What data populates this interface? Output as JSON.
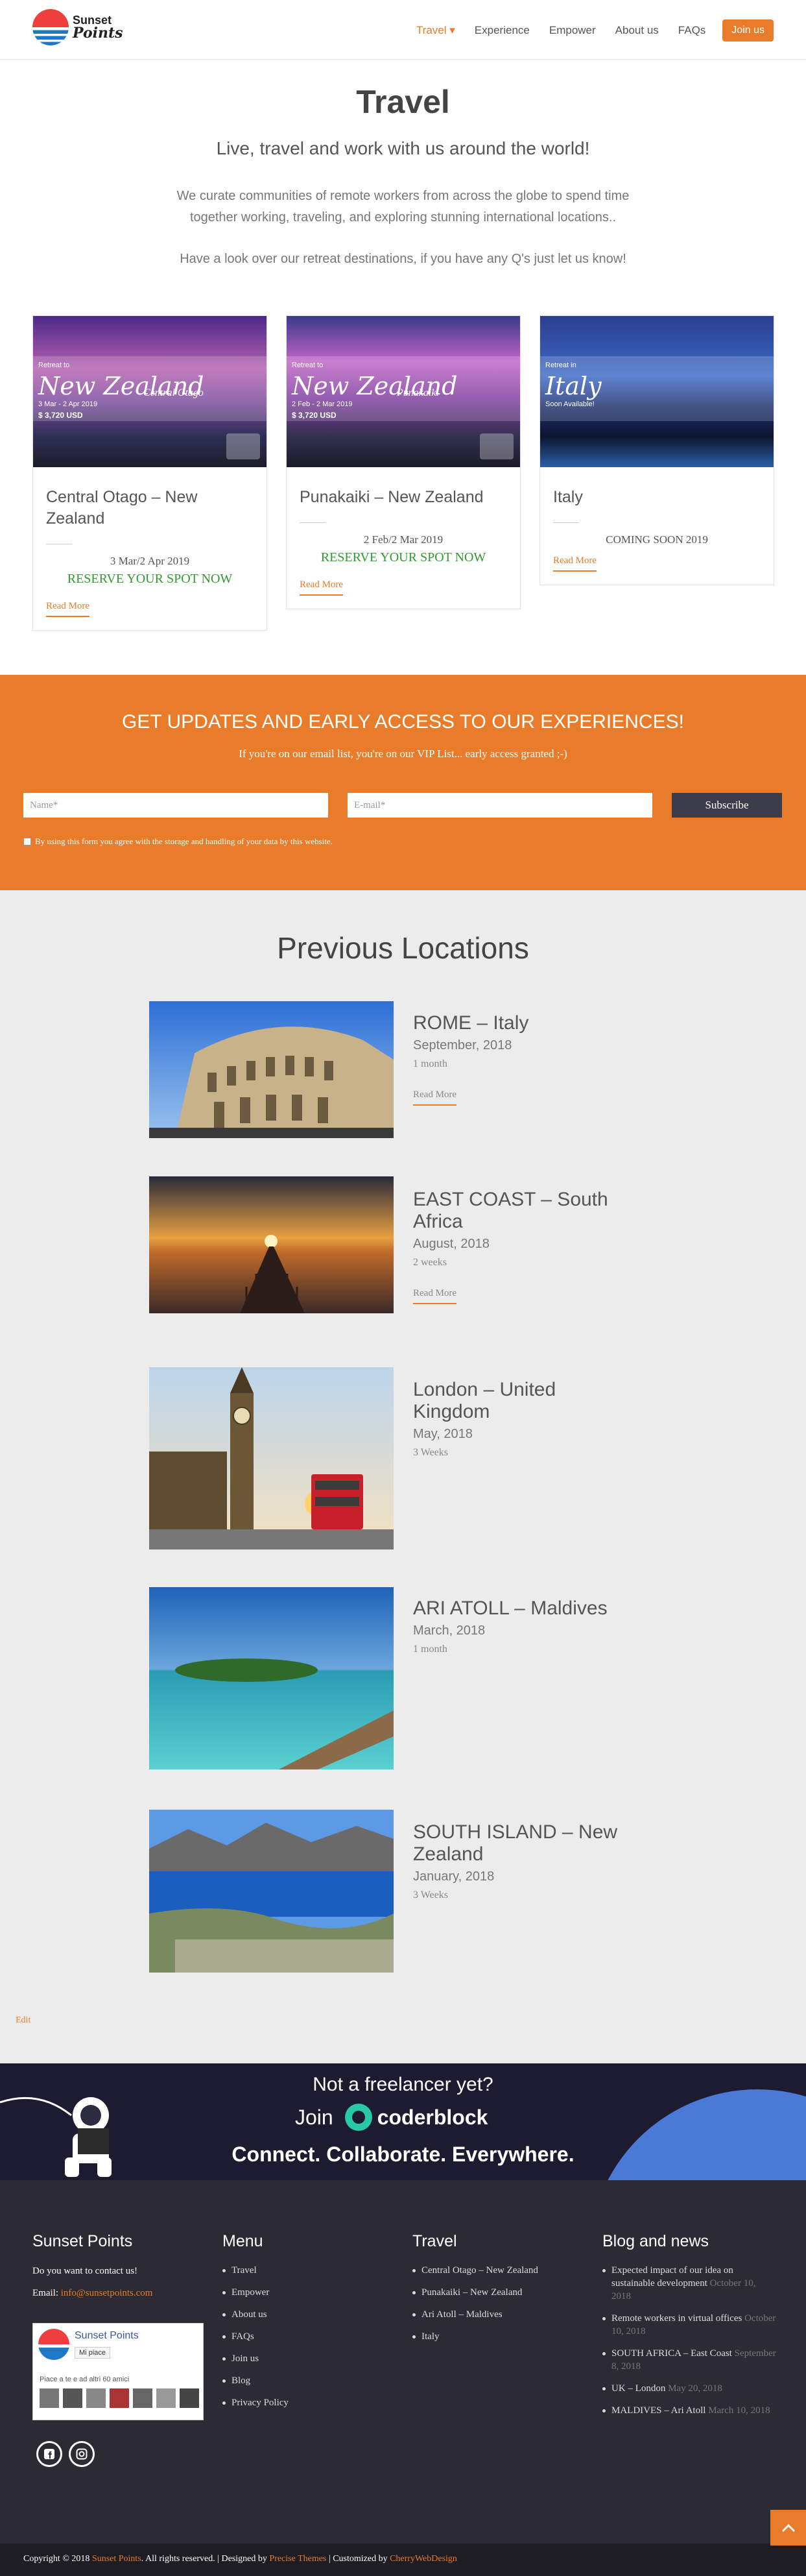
{
  "header": {
    "logo_line1": "Sunset",
    "logo_line2": "Points",
    "nav": [
      "Travel ▾",
      "Experience",
      "Empower",
      "About us",
      "FAQs"
    ],
    "join": "Join us"
  },
  "hero": {
    "title": "Travel",
    "subtitle": "Live, travel and work with us around the world!",
    "p1": "We curate communities of remote workers from across the globe to spend time",
    "p2": "together working, traveling, and exploring stunning international locations..",
    "p3": "Have a look over our retreat destinations, if you have any Q's just let us know!"
  },
  "cards": [
    {
      "img_pre": "Retreat to",
      "img_title": "New Zealand",
      "img_place": "Central Otago",
      "img_dates": "3 Mar - 2 Apr 2019",
      "img_price": "$ 3,720 USD",
      "title": "Central Otago – New Zealand",
      "date": "3 Mar/2 Apr 2019",
      "spot": "RESERVE YOUR SPOT NOW",
      "more": "Read More"
    },
    {
      "img_pre": "Retreat to",
      "img_title": "New Zealand",
      "img_place": "Punakaiki",
      "img_dates": "2 Feb - 2 Mar 2019",
      "img_price": "$ 3,720 USD",
      "title": "Punakaiki – New Zealand",
      "date": "2 Feb/2 Mar 2019",
      "spot": "RESERVE YOUR SPOT NOW",
      "more": "Read More"
    },
    {
      "img_pre": "Retreat in",
      "img_title": "Italy",
      "img_place": "",
      "img_dates": "Soon Available!",
      "img_price": "",
      "title": "Italy",
      "date": "COMING SOON 2019",
      "spot": "",
      "more": "Read More"
    }
  ],
  "signup": {
    "title": "GET UPDATES AND EARLY ACCESS TO OUR EXPERIENCES!",
    "subtitle": "If you're on our email list, you're on our VIP List... early access granted ;-)",
    "name_placeholder": "Name*",
    "email_placeholder": "E-mail*",
    "button": "Subscribe",
    "consent": "By using this form you agree with the storage and handling of your data by this website."
  },
  "previous": {
    "title": "Previous Locations",
    "items": [
      {
        "name": "ROME – Italy",
        "date": "September, 2018",
        "duration": "1 month",
        "more": "Read More"
      },
      {
        "name": "EAST COAST – South Africa",
        "date": "August, 2018",
        "duration": "2 weeks",
        "more": "Read More"
      },
      {
        "name": "London – United Kingdom",
        "date": "May, 2018",
        "duration": "3 Weeks",
        "more": ""
      },
      {
        "name": "ARI ATOLL – Maldives",
        "date": "March, 2018",
        "duration": "1 month",
        "more": ""
      },
      {
        "name": "SOUTH ISLAND – New Zealand",
        "date": "January, 2018",
        "duration": "3 Weeks",
        "more": ""
      }
    ],
    "edit": "Edit"
  },
  "banner": {
    "line1": "Not a freelancer yet?",
    "join": "Join",
    "brand": "coderblock",
    "line3": "Connect. Collaborate. Everywhere."
  },
  "footer": {
    "col1_title": "Sunset Points",
    "contact": "Do you want to contact us!",
    "email_label": "Email:",
    "email": "info@sunsetpoints.com",
    "fb_name": "Sunset Points",
    "fb_like": "Mi piace",
    "fb_friends": "Piace a te e ad altri 60 amici",
    "col2_title": "Menu",
    "menu": [
      "Travel",
      "Empower",
      "About us",
      "FAQs",
      "Join us",
      "Blog",
      "Privacy Policy"
    ],
    "col3_title": "Travel",
    "travel": [
      "Central Otago – New Zealand",
      "Punakaiki – New Zealand",
      "Ari Atoll – Maldives",
      "Italy"
    ],
    "col4_title": "Blog and news",
    "news": [
      {
        "title": "Expected impact of our idea on sustainable development",
        "date": "October 10, 2018"
      },
      {
        "title": "Remote workers in virtual offices",
        "date": "October 10, 2018"
      },
      {
        "title": "SOUTH AFRICA – East Coast",
        "date": "September 8, 2018"
      },
      {
        "title": "UK – London",
        "date": "May 20, 2018"
      },
      {
        "title": "MALDIVES – Ari Atoll",
        "date": "March 10, 2018"
      }
    ]
  },
  "bottom": {
    "pre": "Copyright © 2018",
    "brand": "Sunset Points",
    "mid": ". All rights reserved. | Designed by",
    "designer": "Precise Themes",
    "mid2": "| Customized by",
    "customizer": "CherryWebDesign"
  }
}
